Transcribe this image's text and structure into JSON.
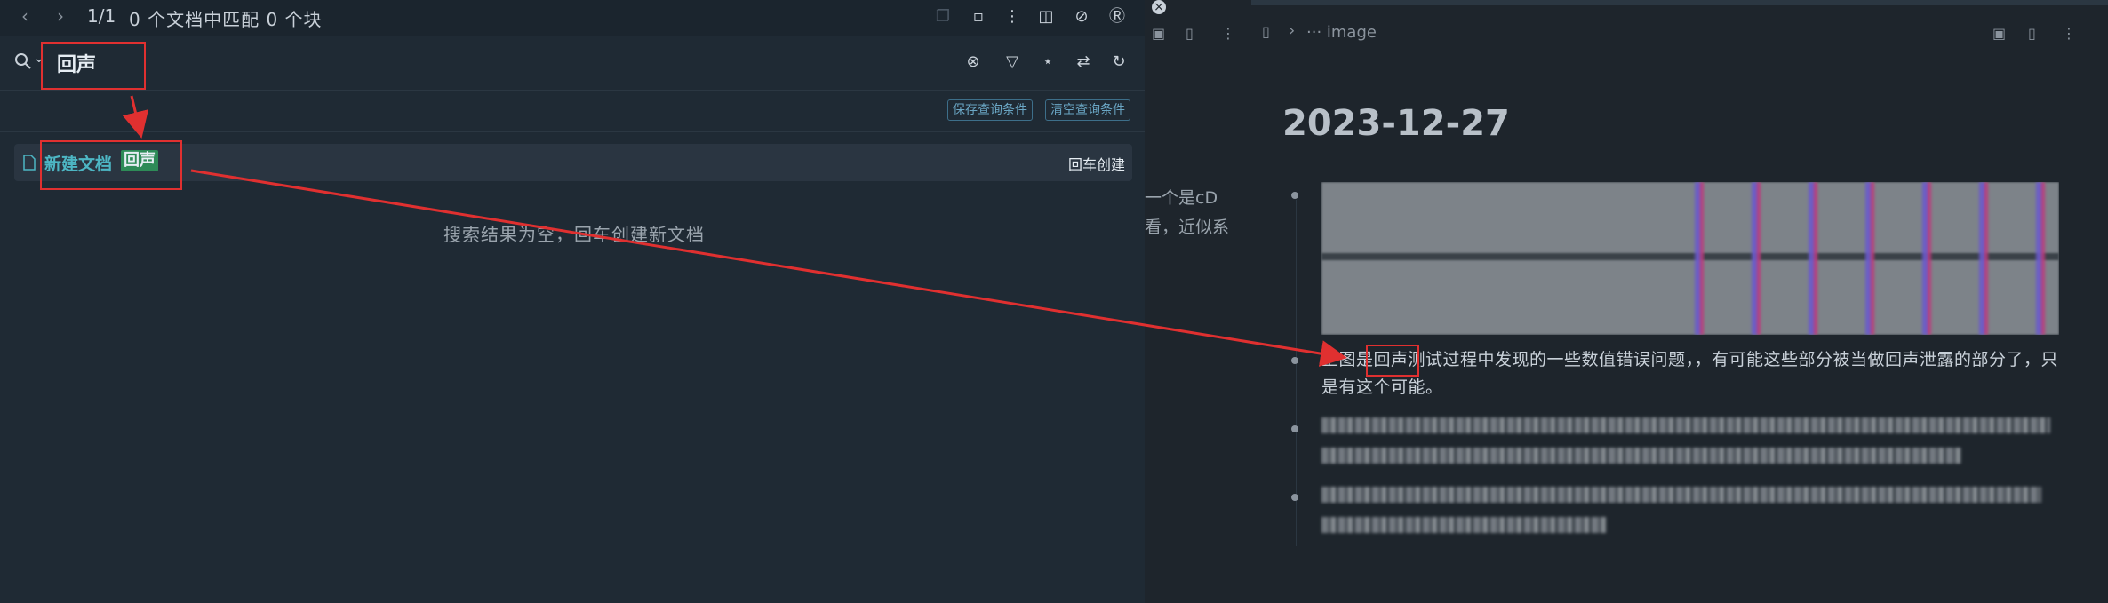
{
  "search_panel": {
    "counter": "1/1",
    "match_summary": "0 个文档中匹配 0 个块",
    "query": "回声",
    "save_query_label": "保存查询条件",
    "clear_query_label": "清空查询条件",
    "result": {
      "new_doc_label": "新建文档",
      "keyword": "回声",
      "enter_create_label": "回车创建"
    },
    "empty_message": "搜索结果为空，回车创建新文档"
  },
  "middle": {
    "snippet1": "一个是cD",
    "snippet2": "看，近似系"
  },
  "editor": {
    "breadcrumb": "··· image",
    "title": "2023-12-27",
    "paragraph1": "上图是回声测试过程中发现的一些数值错误问题，，有可能这些部分被当做回声泄露的部分了，只是有这个可能。"
  },
  "colors": {
    "accent_teal": "#4db6c4",
    "highlight_green": "#2e8b57",
    "annotation_red": "#e03030",
    "panel_bg": "#1f2a34"
  }
}
